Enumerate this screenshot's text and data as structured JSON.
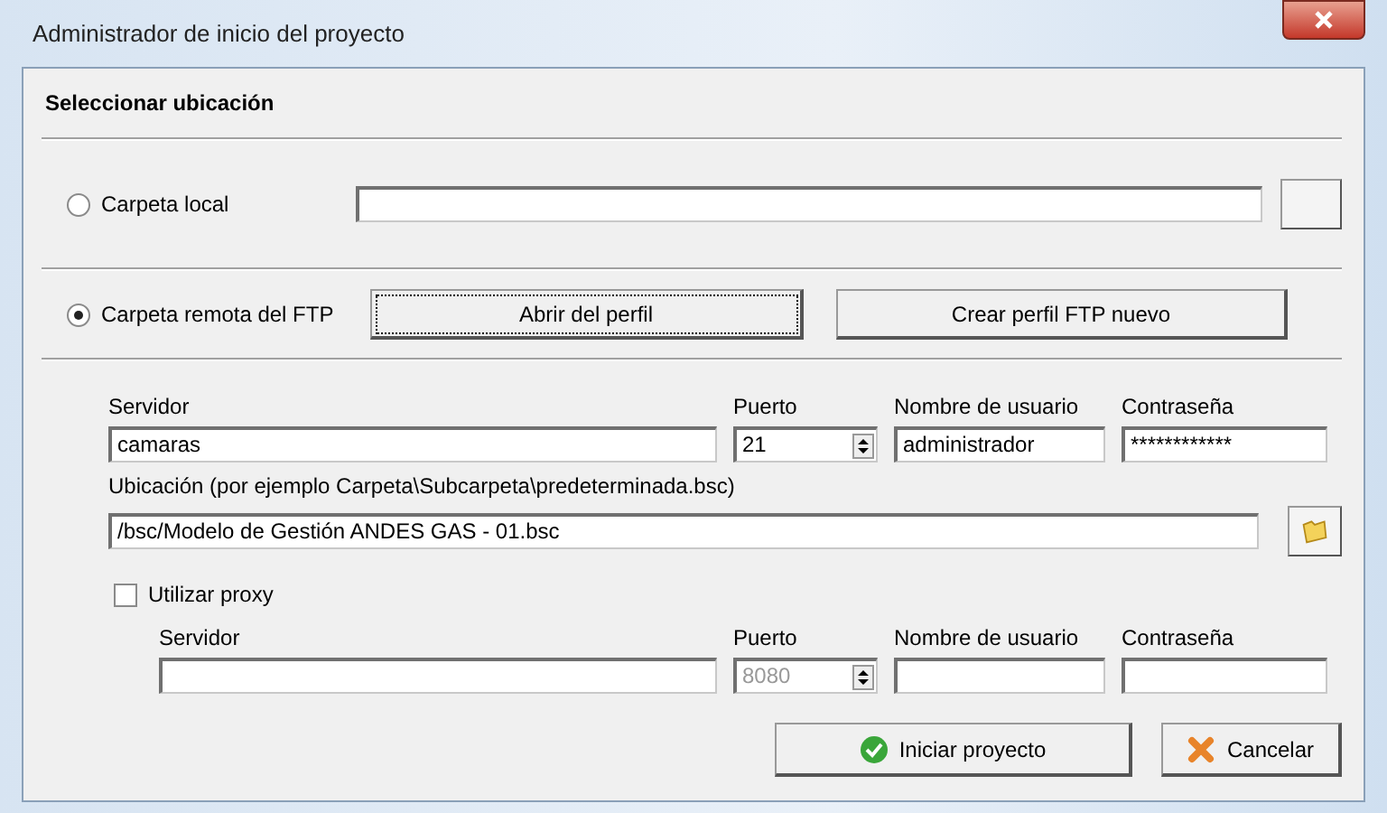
{
  "window": {
    "title": "Administrador de inicio del proyecto"
  },
  "section_title": "Seleccionar ubicación",
  "local": {
    "label": "Carpeta local",
    "selected": false
  },
  "remote": {
    "label": "Carpeta remota del FTP",
    "selected": true,
    "buttons": [
      {
        "label": "Abrir del perfil",
        "focused": true
      },
      {
        "label": "Crear perfil FTP nuevo",
        "focused": false
      }
    ]
  },
  "ftp": {
    "server": {
      "label": "Servidor",
      "value": "camaras"
    },
    "port": {
      "label": "Puerto",
      "value": "21",
      "disabled": false
    },
    "user": {
      "label": "Nombre de usuario",
      "value": "administrador"
    },
    "password": {
      "label": "Contraseña",
      "value": "************"
    },
    "location": {
      "label": "Ubicación (por ejemplo Carpeta\\Subcarpeta\\predeterminada.bsc)",
      "value": "/bsc/Modelo de Gestión ANDES GAS - 01.bsc"
    }
  },
  "proxy": {
    "label": "Utilizar proxy",
    "checked": false,
    "server": {
      "label": "Servidor"
    },
    "port": {
      "label": "Puerto",
      "value": "8080",
      "disabled": true
    },
    "user": {
      "label": "Nombre de usuario"
    },
    "password": {
      "label": "Contraseña"
    }
  },
  "buttons": [
    {
      "label": "Iniciar proyecto",
      "kind": "ok"
    },
    {
      "label": "Cancelar",
      "kind": "cancel"
    }
  ]
}
